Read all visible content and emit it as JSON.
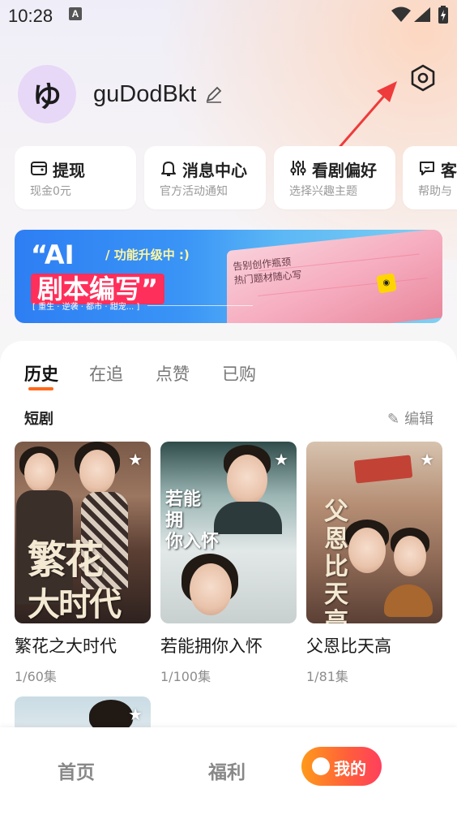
{
  "status": {
    "time": "10:28",
    "notif_icon": "A"
  },
  "profile": {
    "avatar_text": "ゆ",
    "username": "guDodBkt"
  },
  "quick_actions": [
    {
      "title": "提现",
      "subtitle": "现金0元",
      "icon": "wallet-icon"
    },
    {
      "title": "消息中心",
      "subtitle": "官方活动通知",
      "icon": "bell-icon"
    },
    {
      "title": "看剧偏好",
      "subtitle": "选择兴趣主题",
      "icon": "sliders-icon"
    },
    {
      "title": "客",
      "subtitle": "帮助与",
      "icon": "chat-icon"
    }
  ],
  "banner": {
    "line1": "“AI",
    "line2": "剧本编写”",
    "upgrade": "/ 功能升级中 :)",
    "tags": "[ 重生 · 逆袭 · 都市 · 甜宠... ]",
    "book_text_1": "告别创作瓶颈",
    "book_text_2": "热门题材随心写"
  },
  "tabs": [
    "历史",
    "在追",
    "点赞",
    "已购"
  ],
  "section": {
    "title": "短剧",
    "edit_label": "编辑"
  },
  "dramas": [
    {
      "name": "繁花之大时代",
      "episodes": "1/60集",
      "poster_text": "繁花之大时代"
    },
    {
      "name": "若能拥你入怀",
      "episodes": "1/100集",
      "poster_text": "若能拥你入怀"
    },
    {
      "name": "父恩比天高",
      "episodes": "1/81集",
      "poster_text": "父恩比天高"
    }
  ],
  "bottom_nav": {
    "home": "首页",
    "welfare": "福利",
    "mine": "我的"
  },
  "colors": {
    "accent": "#ff6a1a",
    "banner_blue": "#2e7ef3",
    "nav_gradient_end": "#ff3f5e"
  }
}
